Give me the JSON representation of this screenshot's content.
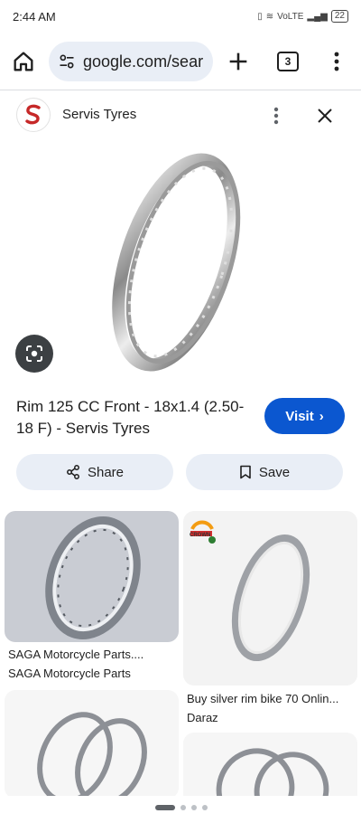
{
  "status_bar": {
    "time": "2:44 AM",
    "network": "VoLTE",
    "battery": "22"
  },
  "browser": {
    "url": "google.com/sear",
    "tab_count": "3"
  },
  "source": {
    "name": "Servis Tyres",
    "logo_letter": "S"
  },
  "result": {
    "title": "Rim 125 CC Front - 18x1.4 (2.50-18 F) - Servis Tyres",
    "visit_label": "Visit",
    "share_label": "Share",
    "save_label": "Save"
  },
  "related": [
    {
      "title": "SAGA Motorcycle Parts....",
      "source": "SAGA Motorcycle Parts"
    },
    {
      "title": "Buy silver rim bike 70 Onlin...",
      "source": "Daraz",
      "badge": "CROWN"
    },
    {
      "title": "",
      "source": ""
    },
    {
      "title": "",
      "source": ""
    }
  ],
  "icons": {
    "home": "home-icon",
    "tune": "tune-icon",
    "plus": "plus-icon",
    "tabs": "tabs-icon",
    "menu": "more-vert-icon",
    "close": "close-icon",
    "lens": "lens-icon",
    "share": "share-icon",
    "bookmark": "bookmark-icon"
  },
  "colors": {
    "accent": "#0b57d0",
    "pill_bg": "#e9eef6",
    "logo_red": "#c62828"
  }
}
